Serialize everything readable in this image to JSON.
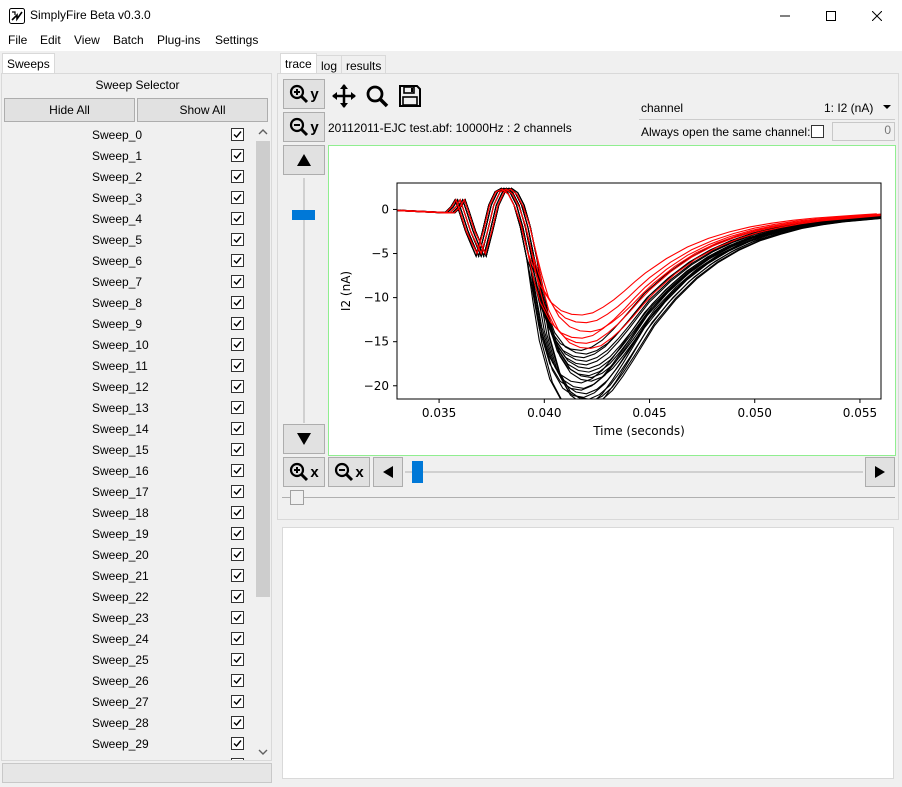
{
  "window": {
    "title": "SimplyFire Beta v0.3.0",
    "controls": [
      "minimize",
      "maximize",
      "close"
    ]
  },
  "menu": [
    "File",
    "Edit",
    "View",
    "Batch",
    "Plug-ins",
    "Settings"
  ],
  "left": {
    "tab": "Sweeps",
    "header": "Sweep Selector",
    "hide_all": "Hide All",
    "show_all": "Show All",
    "sweeps": [
      "Sweep_0",
      "Sweep_1",
      "Sweep_2",
      "Sweep_3",
      "Sweep_4",
      "Sweep_5",
      "Sweep_6",
      "Sweep_7",
      "Sweep_8",
      "Sweep_9",
      "Sweep_10",
      "Sweep_11",
      "Sweep_12",
      "Sweep_13",
      "Sweep_14",
      "Sweep_15",
      "Sweep_16",
      "Sweep_17",
      "Sweep_18",
      "Sweep_19",
      "Sweep_20",
      "Sweep_21",
      "Sweep_22",
      "Sweep_23",
      "Sweep_24",
      "Sweep_25",
      "Sweep_26",
      "Sweep_27",
      "Sweep_28",
      "Sweep_29"
    ],
    "all_checked": true
  },
  "right": {
    "tabs": [
      "trace",
      "log",
      "results"
    ],
    "active_tab": "trace",
    "file_info": "20112011-EJC test.abf: 10000Hz : 2 channels",
    "channel_label": "channel",
    "channel_value": "1: I2 (nA)",
    "always_open_label": "Always open the same channel:",
    "always_open_checked": false,
    "channel_index": "0",
    "toolbar": {
      "zoom_in_y": "y",
      "zoom_out_y": "y",
      "zoom_in_x": "x",
      "zoom_out_x": "x"
    }
  },
  "chart_data": {
    "type": "line",
    "title": "",
    "xlabel": "Time (seconds)",
    "ylabel": "I2 (nA)",
    "xlim": [
      0.033,
      0.056
    ],
    "ylim": [
      -21.5,
      3.0
    ],
    "xticks": [
      "0.035",
      "0.040",
      "0.045",
      "0.050",
      "0.055"
    ],
    "xtick_values": [
      0.035,
      0.04,
      0.045,
      0.05,
      0.055
    ],
    "yticks": [
      "0",
      "−5",
      "−10",
      "−15",
      "−20"
    ],
    "ytick_values": [
      0,
      -5,
      -10,
      -15,
      -20
    ],
    "colors": {
      "black": "#000000",
      "red": "#ff0000"
    },
    "series_black_template": {
      "x": [
        0.033,
        0.0355,
        0.0358,
        0.036,
        0.0362,
        0.0365,
        0.0368,
        0.037,
        0.0373,
        0.0376,
        0.0379,
        0.0382,
        0.0385,
        0.0388,
        0.0391,
        0.0394,
        0.0397,
        0.04,
        0.0405,
        0.041,
        0.0415,
        0.042,
        0.0425,
        0.043,
        0.0435,
        0.044,
        0.0445,
        0.045,
        0.046,
        0.047,
        0.048,
        0.049,
        0.05,
        0.051,
        0.052,
        0.053,
        0.054,
        0.055,
        0.056
      ],
      "y": [
        -0.1,
        -0.4,
        0.3,
        1.1,
        -0.3,
        -2.5,
        -4.2,
        -5.3,
        -2.5,
        0.5,
        2.0,
        2.4,
        1.9,
        0.5,
        -2.0,
        -5.5,
        -9.5,
        -13.5,
        -17.5,
        -19.5,
        -20.3,
        -20.5,
        -20.0,
        -19.0,
        -17.5,
        -15.8,
        -14.0,
        -12.2,
        -9.5,
        -7.3,
        -5.6,
        -4.3,
        -3.3,
        -2.6,
        -2.0,
        -1.6,
        -1.3,
        -1.1,
        -0.9
      ]
    },
    "series_red_template": {
      "x": [
        0.033,
        0.0355,
        0.0358,
        0.036,
        0.0362,
        0.0365,
        0.0368,
        0.037,
        0.0373,
        0.0376,
        0.0379,
        0.0382,
        0.0385,
        0.0388,
        0.0391,
        0.0394,
        0.0397,
        0.04,
        0.0405,
        0.041,
        0.0415,
        0.042,
        0.0425,
        0.043,
        0.0435,
        0.044,
        0.0445,
        0.045,
        0.046,
        0.047,
        0.048,
        0.049,
        0.05,
        0.051,
        0.052,
        0.053,
        0.054,
        0.055,
        0.056
      ],
      "y": [
        -0.1,
        -0.4,
        0.3,
        1.1,
        -0.3,
        -2.5,
        -4.0,
        -5.0,
        -2.5,
        0.5,
        2.0,
        2.3,
        1.7,
        0.3,
        -1.8,
        -4.8,
        -8.0,
        -10.5,
        -12.8,
        -14.0,
        -14.5,
        -14.6,
        -14.3,
        -13.5,
        -12.5,
        -11.3,
        -10.0,
        -8.8,
        -6.8,
        -5.2,
        -4.0,
        -3.1,
        -2.4,
        -1.9,
        -1.5,
        -1.2,
        -1.0,
        -0.8,
        -0.6
      ]
    },
    "black_scales": [
      0.78,
      0.82,
      0.86,
      0.9,
      0.93,
      0.96,
      0.99,
      1.02,
      1.05,
      1.08,
      1.1,
      1.12,
      0.84,
      0.88,
      0.95,
      1.0,
      1.04,
      0.8,
      0.92,
      1.06
    ],
    "red_scales": [
      0.82,
      0.88,
      0.95,
      1.0,
      1.04,
      1.08
    ]
  }
}
